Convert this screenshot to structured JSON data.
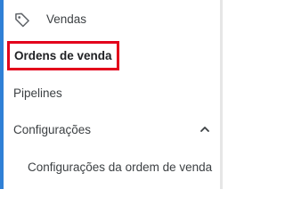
{
  "nav": {
    "vendas": {
      "label": "Vendas",
      "icon": "tag-icon"
    },
    "ordens_de_venda": {
      "label": "Ordens de venda",
      "highlight_color": "#e3001b"
    },
    "pipelines": {
      "label": "Pipelines"
    },
    "configuracoes": {
      "label": "Configurações",
      "icon": "chevron-up-icon",
      "expanded": true
    },
    "configuracoes_ordem": {
      "label": "Configurações da ordem de venda"
    }
  },
  "colors": {
    "accent": "#2f80d6",
    "text": "#3c4043"
  }
}
